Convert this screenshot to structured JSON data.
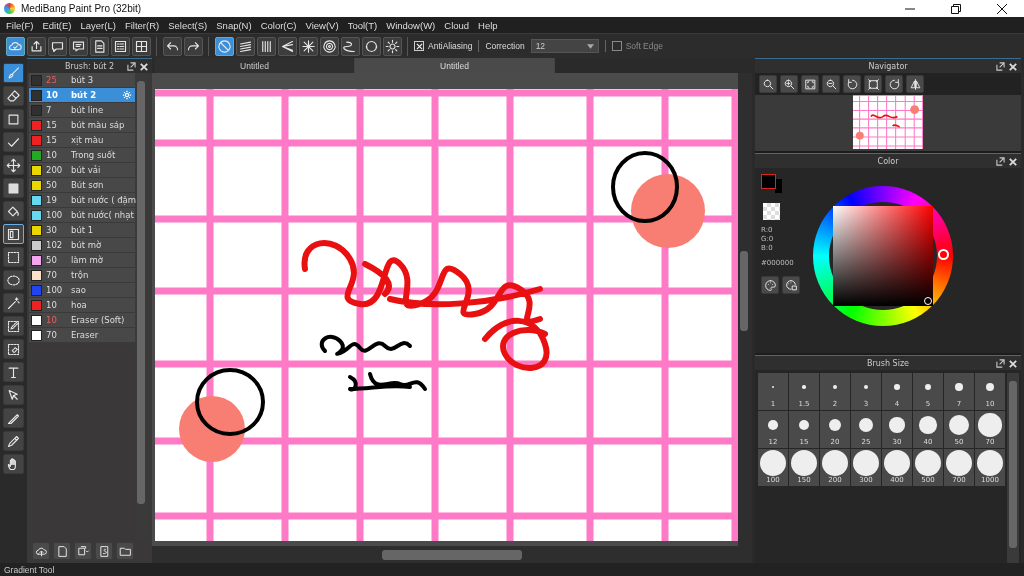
{
  "window": {
    "title": "MediBang Paint Pro (32bit)"
  },
  "menu": [
    "File(F)",
    "Edit(E)",
    "Layer(L)",
    "Filter(R)",
    "Select(S)",
    "Snap(N)",
    "Color(C)",
    "View(V)",
    "Tool(T)",
    "Window(W)",
    "Cloud",
    "Help"
  ],
  "toolbar": {
    "groups": [
      [
        {
          "kind": "cloud-check",
          "selected": true
        },
        {
          "kind": "upload",
          "selected": false
        },
        {
          "kind": "speech-bubble",
          "selected": false
        },
        {
          "kind": "message",
          "selected": false
        },
        {
          "kind": "document",
          "selected": false
        },
        {
          "kind": "list",
          "selected": false
        },
        {
          "kind": "grid",
          "selected": false
        }
      ],
      [
        {
          "kind": "undo",
          "selected": false
        },
        {
          "kind": "redo",
          "selected": false
        }
      ],
      [
        {
          "kind": "no-entry",
          "selected": true
        },
        {
          "kind": "parallel-lines",
          "selected": false
        },
        {
          "kind": "vertical-lines",
          "selected": false
        },
        {
          "kind": "perspective-lines",
          "selected": false
        },
        {
          "kind": "radial-lines",
          "selected": false
        },
        {
          "kind": "concentric-circles",
          "selected": false
        },
        {
          "kind": "curve",
          "selected": false
        },
        {
          "kind": "circle",
          "selected": false
        },
        {
          "kind": "gear",
          "selected": false
        }
      ]
    ],
    "antialiasing": {
      "label": "AntiAliasing",
      "checked": true
    },
    "correction": {
      "label": "Correction",
      "value": "12"
    },
    "soft_edge": {
      "label": "Soft Edge",
      "checked": false
    }
  },
  "tools": [
    {
      "kind": "brush",
      "selected": true
    },
    {
      "kind": "eraser",
      "selected": false
    },
    {
      "kind": "square-outline",
      "selected": false
    },
    {
      "kind": "checkmark",
      "selected": false
    },
    {
      "kind": "move-arrows",
      "selected": false
    },
    {
      "kind": "filled-square",
      "selected": false
    },
    {
      "kind": "paint-bucket",
      "selected": false
    },
    {
      "kind": "gradient-square",
      "selected": false,
      "outlined": true
    },
    {
      "kind": "dashed-square",
      "selected": false
    },
    {
      "kind": "dashed-ellipse",
      "selected": false
    },
    {
      "kind": "magic-wand",
      "selected": false
    },
    {
      "kind": "pen-selection",
      "selected": false
    },
    {
      "kind": "eraser-selection",
      "selected": false
    },
    {
      "kind": "text-t",
      "selected": false
    },
    {
      "kind": "cursor-lasso",
      "selected": false
    },
    {
      "kind": "knife",
      "selected": false
    },
    {
      "kind": "eyedropper",
      "selected": false
    },
    {
      "kind": "hand",
      "selected": false
    }
  ],
  "brush_panel": {
    "title": "Brush: bút 2",
    "brushes": [
      {
        "color": "#303030",
        "size": "25",
        "name": "bút 3",
        "size_marked": true,
        "selected": false
      },
      {
        "color": "#303030",
        "size": "10",
        "name": "bút 2",
        "size_marked": false,
        "selected": true
      },
      {
        "color": "#303030",
        "size": "7",
        "name": "bút line",
        "size_marked": false,
        "selected": false
      },
      {
        "color": "#ee2222",
        "size": "15",
        "name": "bút màu sáp",
        "size_marked": false,
        "selected": false
      },
      {
        "color": "#ee2222",
        "size": "15",
        "name": "xịt màu",
        "size_marked": false,
        "selected": false
      },
      {
        "color": "#22aa22",
        "size": "10",
        "name": "Trong suốt",
        "size_marked": false,
        "selected": false
      },
      {
        "color": "#e8d800",
        "size": "200",
        "name": "bút vải",
        "size_marked": false,
        "selected": false
      },
      {
        "color": "#e8d800",
        "size": "50",
        "name": "Bút sơn",
        "size_marked": false,
        "selected": false
      },
      {
        "color": "#66d8f0",
        "size": "19",
        "name": "bút nước ( đậm",
        "size_marked": false,
        "selected": false
      },
      {
        "color": "#66d8f0",
        "size": "100",
        "name": "bút nước( nhạt",
        "size_marked": false,
        "selected": false
      },
      {
        "color": "#e8d800",
        "size": "30",
        "name": "bút 1",
        "size_marked": false,
        "selected": false
      },
      {
        "color": "#cccccc",
        "size": "102",
        "name": "bút mờ",
        "size_marked": false,
        "selected": false
      },
      {
        "color": "#f4a6f0",
        "size": "50",
        "name": "làm mờ",
        "size_marked": false,
        "selected": false
      },
      {
        "color": "#fde0cc",
        "size": "70",
        "name": "trộn",
        "size_marked": false,
        "selected": false
      },
      {
        "color": "#2244ee",
        "size": "100",
        "name": "sao",
        "size_marked": false,
        "selected": false
      },
      {
        "color": "#ee2222",
        "size": "10",
        "name": "hoa",
        "size_marked": false,
        "selected": false
      },
      {
        "color": "#ffffff",
        "size": "10",
        "name": "Eraser (Soft)",
        "size_marked": true,
        "selected": false
      },
      {
        "color": "#ffffff",
        "size": "70",
        "name": "Eraser",
        "size_marked": false,
        "selected": false
      }
    ]
  },
  "tabs": [
    {
      "label": "Untitled",
      "selected": false
    },
    {
      "label": "Untitled",
      "selected": true
    }
  ],
  "navigator": {
    "title": "Navigator"
  },
  "color": {
    "title": "Color",
    "r": "R:0",
    "g": "G:0",
    "b": "B:0",
    "hex": "#000000"
  },
  "brush_size": {
    "title": "Brush Size",
    "sizes": [
      "1",
      "1.5",
      "2",
      "3",
      "4",
      "5",
      "7",
      "10",
      "12",
      "15",
      "20",
      "25",
      "30",
      "40",
      "50",
      "70",
      "100",
      "150",
      "200",
      "300",
      "400",
      "500",
      "700",
      "1000"
    ]
  },
  "status_bar": "Gradient Tool"
}
